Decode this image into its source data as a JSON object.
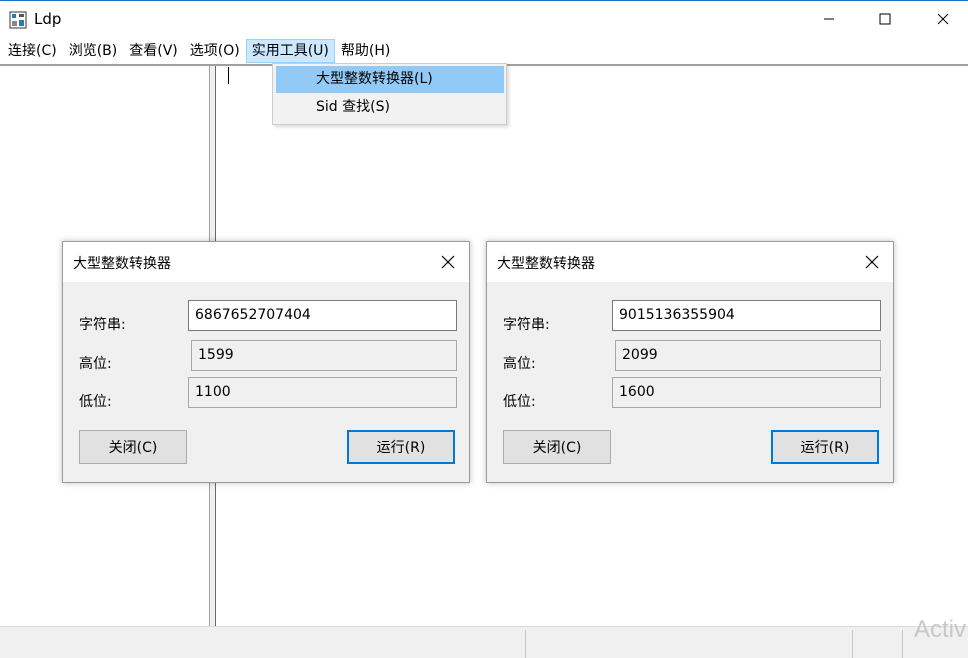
{
  "window": {
    "title": "Ldp"
  },
  "menu": [
    {
      "label": "连接(C)"
    },
    {
      "label": "浏览(B)"
    },
    {
      "label": "查看(V)"
    },
    {
      "label": "选项(O)"
    },
    {
      "label": "实用工具(U)",
      "active": true
    },
    {
      "label": "帮助(H)"
    }
  ],
  "dropdown": {
    "items": [
      {
        "label": "大型整数转换器(L)",
        "highlighted": true
      },
      {
        "label": "Sid 查找(S)"
      }
    ]
  },
  "dialogs": [
    {
      "title": "大型整数转换器",
      "string_label": "字符串:",
      "string_value": "6867652707404",
      "high_label": "高位:",
      "high_value": "1599",
      "low_label": "低位:",
      "low_value": "1100",
      "close_button": "关闭(C)",
      "run_button": "运行(R)"
    },
    {
      "title": "大型整数转换器",
      "string_label": "字符串:",
      "string_value": "9015136355904",
      "high_label": "高位:",
      "high_value": "2099",
      "low_label": "低位:",
      "low_value": "1600",
      "close_button": "关闭(C)",
      "run_button": "运行(R)"
    }
  ],
  "watermark": "Activ",
  "colors": {
    "menu_highlight": "#91c9f7",
    "default_button_border": "#0078d7",
    "title_accent": "#1a73c8"
  }
}
